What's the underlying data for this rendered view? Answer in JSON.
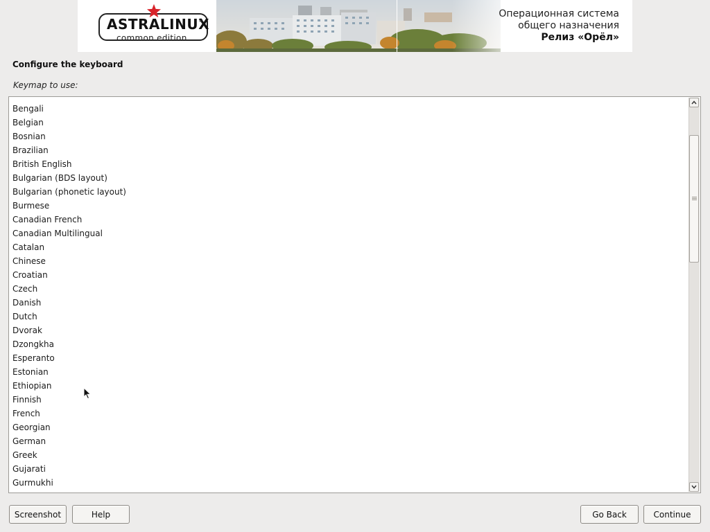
{
  "banner": {
    "logo_title": "ASTRALINUX",
    "logo_registered": "®",
    "logo_subtitle": "common edition",
    "os_line1": "Операционная система",
    "os_line2": "общего назначения",
    "release": "Релиз «Орёл»",
    "star_color": "#d8232a"
  },
  "page": {
    "title": "Configure the keyboard",
    "keymap_label": "Keymap to use:"
  },
  "keymaps": [
    "Bengali",
    "Belgian",
    "Bosnian",
    "Brazilian",
    "British English",
    "Bulgarian (BDS layout)",
    "Bulgarian (phonetic layout)",
    "Burmese",
    "Canadian French",
    "Canadian Multilingual",
    "Catalan",
    "Chinese",
    "Croatian",
    "Czech",
    "Danish",
    "Dutch",
    "Dvorak",
    "Dzongkha",
    "Esperanto",
    "Estonian",
    "Ethiopian",
    "Finnish",
    "French",
    "Georgian",
    "German",
    "Greek",
    "Gujarati",
    "Gurmukhi"
  ],
  "buttons": {
    "screenshot": "Screenshot",
    "help": "Help",
    "go_back": "Go Back",
    "continue": "Continue"
  },
  "icons": {
    "scroll_up": "chevron-up-icon",
    "scroll_down": "chevron-down-icon",
    "logo_star": "star-icon",
    "cursor": "mouse-pointer-icon"
  }
}
